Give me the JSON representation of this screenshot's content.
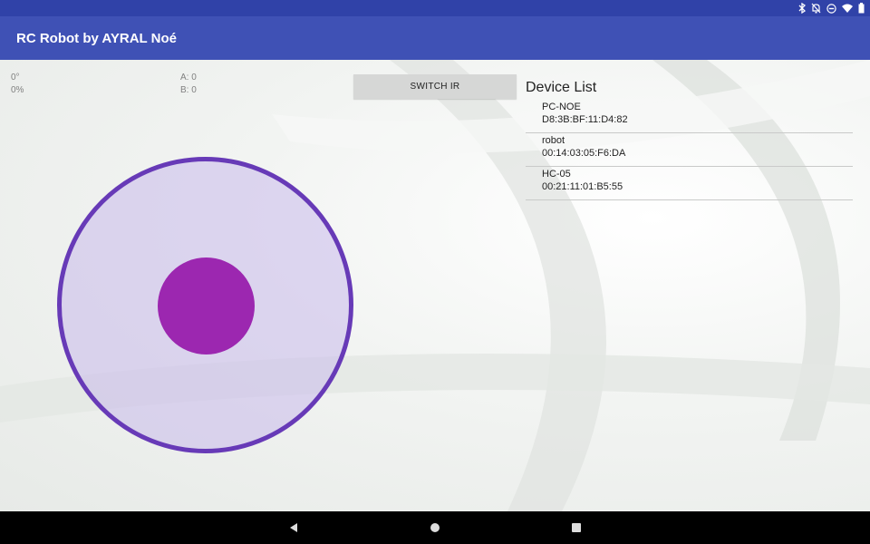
{
  "status_bar": {
    "icons": [
      "bluetooth-icon",
      "notifications-off-icon",
      "do-not-disturb-icon",
      "wifi-icon",
      "battery-icon"
    ]
  },
  "app": {
    "title": "RC Robot by AYRAL Noé"
  },
  "readouts": {
    "angle": "0°",
    "power": "0%",
    "a": "A: 0",
    "b": "B: 0"
  },
  "switch_button": {
    "label": "SWITCH IR"
  },
  "device_list": {
    "title": "Device List",
    "devices": [
      {
        "name": "PC-NOE",
        "mac": "D8:3B:BF:11:D4:82"
      },
      {
        "name": "robot",
        "mac": "00:14:03:05:F6:DA"
      },
      {
        "name": "HC-05",
        "mac": "00:21:11:01:B5:55"
      }
    ]
  },
  "joystick": {
    "ring_color": "#673ab7",
    "knob_color": "#9c27b0"
  },
  "nav_bar": {
    "buttons": [
      "back-icon",
      "home-icon",
      "recents-icon"
    ]
  },
  "colors": {
    "status_bar": "#3042a8",
    "app_bar": "#3f51b5"
  }
}
